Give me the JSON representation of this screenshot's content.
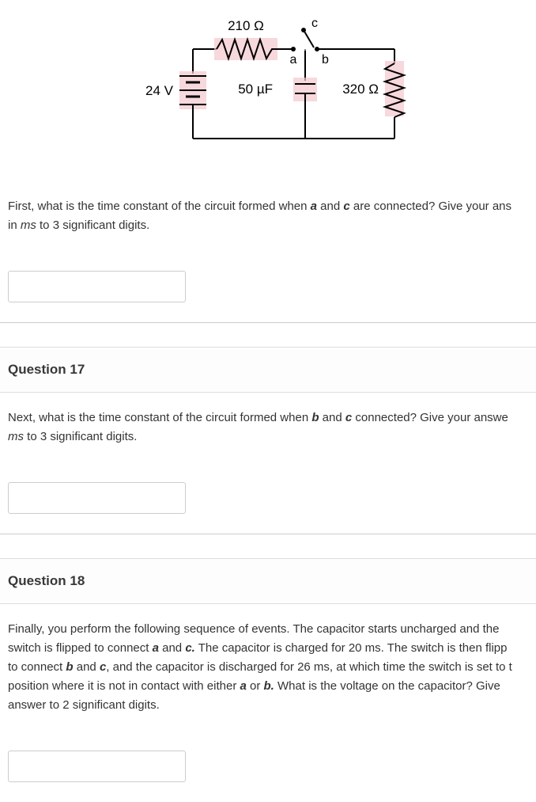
{
  "circuit": {
    "voltage_label": "24 V",
    "r1_label": "210 Ω",
    "capacitor_label": "50 µF",
    "r2_label": "320 Ω",
    "node_a": "a",
    "node_b": "b",
    "node_c": "c"
  },
  "q16": {
    "text_before_a": "First, what is the time constant of the circuit formed when ",
    "a": "a",
    "text_mid": " and ",
    "c": "c",
    "text_after": " are connected? Give your ans",
    "line2_before": "in ",
    "ms": "ms",
    "line2_after": " to 3 significant digits."
  },
  "q17": {
    "header": "Question 17",
    "text_before_b": "Next, what is the time constant of the circuit formed when ",
    "b": "b",
    "text_mid": " and ",
    "c": "c",
    "text_after": " connected? Give your answe",
    "line2_ms": "ms",
    "line2_after": " to 3 significant digits."
  },
  "q18": {
    "header": "Question 18",
    "p_before_a1": "Finally, you perform the following sequence of events.  The capacitor starts uncharged and the switch is flipped to connect ",
    "a": "a",
    "p_mid1": " and ",
    "c": "c.",
    "p_after1": " The capacitor is charged for 20 ms.  The switch is then flipp",
    "p_before_b": "to connect ",
    "b": "b",
    "p_mid2": " and ",
    "c2": "c",
    "p_after2": ", and the capacitor is discharged for 26 ms, at which time the switch is set to t",
    "p_before_a2": "position where it is not in contact with either ",
    "a2": "a",
    "p_mid3": " or ",
    "b2": "b.",
    "p_after3": "  What is the voltage on the capacitor? Give",
    "p_line4": "answer to 2 significant digits."
  }
}
